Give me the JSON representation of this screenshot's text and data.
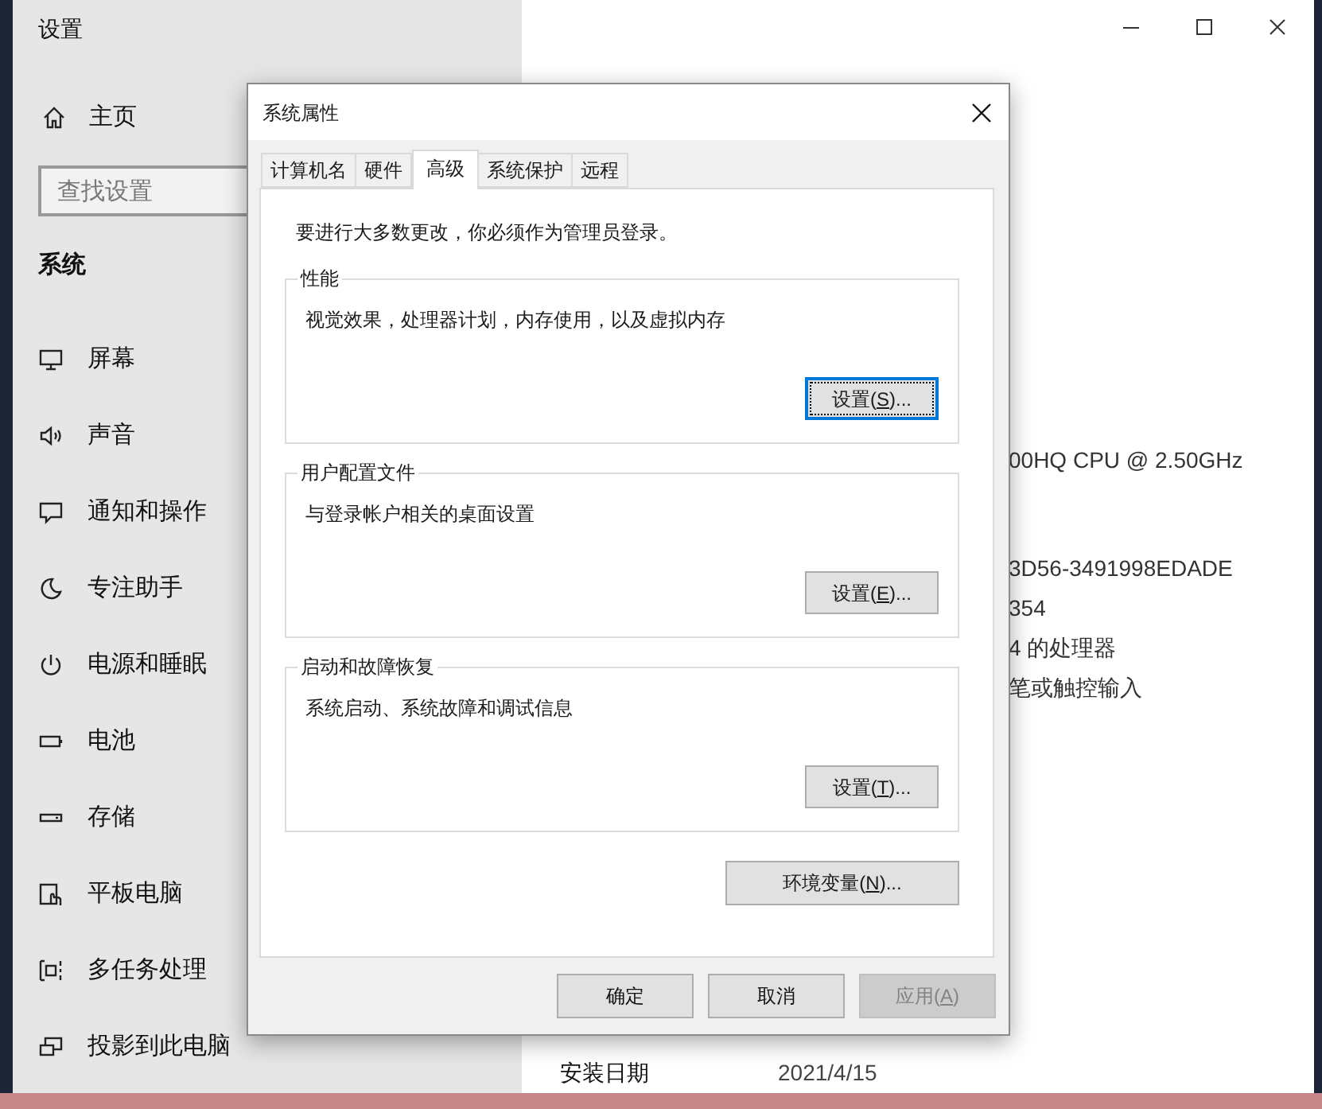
{
  "settings_window": {
    "title": "设置",
    "home": "主页",
    "search": {
      "placeholder": "查找设置"
    },
    "section": "系统",
    "nav_items": [
      {
        "kind": "display",
        "label": "屏幕"
      },
      {
        "kind": "sound",
        "label": "声音"
      },
      {
        "kind": "notifications",
        "label": "通知和操作"
      },
      {
        "kind": "focus",
        "label": "专注助手"
      },
      {
        "kind": "power",
        "label": "电源和睡眠"
      },
      {
        "kind": "battery",
        "label": "电池"
      },
      {
        "kind": "storage",
        "label": "存储"
      },
      {
        "kind": "tablet",
        "label": "平板电脑"
      },
      {
        "kind": "multitasking",
        "label": "多任务处理"
      },
      {
        "kind": "projecting",
        "label": "投影到此电脑"
      }
    ],
    "info_fragments": [
      "00HQ CPU @ 2.50GHz",
      "3D56-3491998EDADE",
      "354",
      "4 的处理器",
      "笔或触控输入"
    ],
    "info_rows": [
      {
        "label": "安装日期",
        "value": "2021/4/15"
      }
    ]
  },
  "dialog": {
    "title": "系统属性",
    "tabs": [
      {
        "label": "计算机名",
        "selected": false
      },
      {
        "label": "硬件",
        "selected": false
      },
      {
        "label": "高级",
        "selected": true
      },
      {
        "label": "系统保护",
        "selected": false
      },
      {
        "label": "远程",
        "selected": false
      }
    ],
    "notice": "要进行大多数更改，你必须作为管理员登录。",
    "groups": [
      {
        "title": "性能",
        "description": "视觉效果，处理器计划，内存使用，以及虚拟内存",
        "button": {
          "pre": "设置(",
          "key": "S",
          "post": ")...",
          "focused": true
        }
      },
      {
        "title": "用户配置文件",
        "description": "与登录帐户相关的桌面设置",
        "button": {
          "pre": "设置(",
          "key": "E",
          "post": ")...",
          "focused": false
        }
      },
      {
        "title": "启动和故障恢复",
        "description": "系统启动、系统故障和调试信息",
        "button": {
          "pre": "设置(",
          "key": "T",
          "post": ")...",
          "focused": false
        }
      }
    ],
    "env_button": {
      "pre": "环境变量(",
      "key": "N",
      "post": ")..."
    },
    "buttons": [
      {
        "pre": "确定",
        "disabled": false
      },
      {
        "pre": "取消",
        "disabled": false
      },
      {
        "pre": "应用(",
        "key": "A",
        "post": ")",
        "disabled": true
      }
    ]
  }
}
